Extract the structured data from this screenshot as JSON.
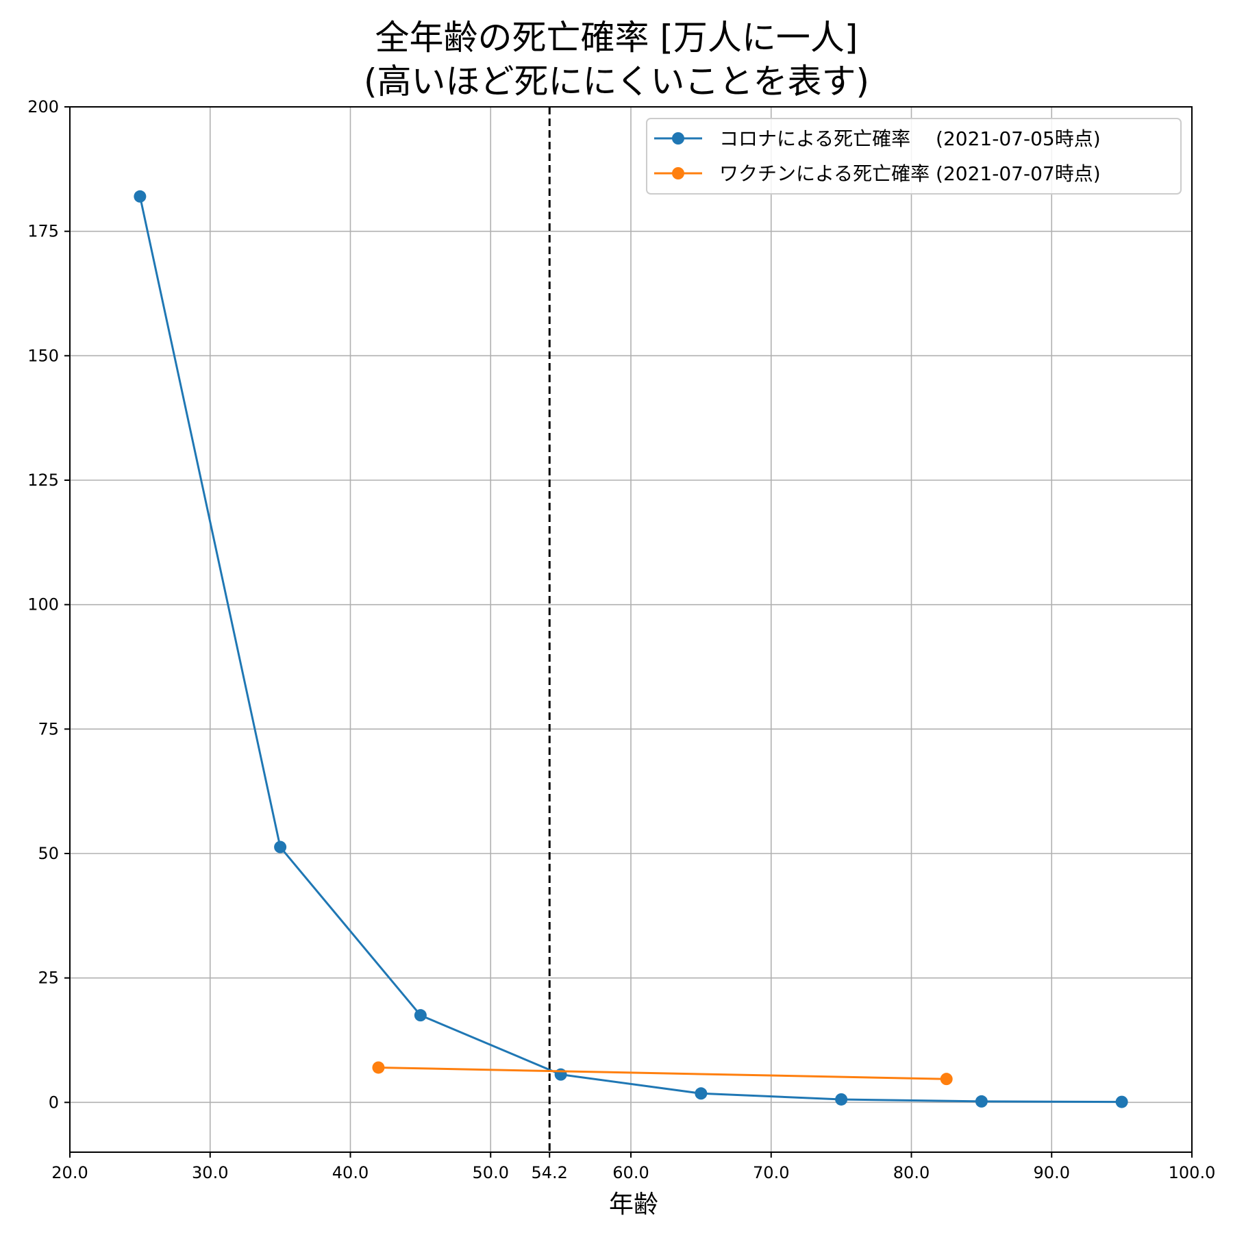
{
  "chart_data": {
    "type": "line",
    "title": "全年齢の死亡確率 [万人に一人]",
    "subtitle": "(高いほど死ににくいことを表す)",
    "xlabel": "年齢",
    "ylabel": "",
    "xlim": [
      20,
      100
    ],
    "ylim": [
      -10,
      200
    ],
    "xticks": [
      20,
      30,
      40,
      50,
      54.2,
      60,
      70,
      80,
      90,
      100
    ],
    "xtick_labels": [
      "20.0",
      "30.0",
      "40.0",
      "50.0",
      "54.2",
      "60.0",
      "70.0",
      "80.0",
      "90.0",
      "100.0"
    ],
    "yticks": [
      0,
      25,
      50,
      75,
      100,
      125,
      150,
      175,
      200
    ],
    "ytick_labels": [
      "0",
      "25",
      "50",
      "75",
      "100",
      "125",
      "150",
      "175",
      "200"
    ],
    "grid": true,
    "legend_position": "top-right",
    "vline": {
      "x": 54.2,
      "style": "dashed",
      "color": "#000000"
    },
    "series": [
      {
        "name": "コロナによる死亡確率　 (2021-07-05時点)",
        "color": "#1f77b4",
        "x": [
          25,
          35,
          45,
          55,
          65,
          75,
          85,
          95
        ],
        "y": [
          182,
          51.3,
          17.5,
          5.6,
          1.8,
          0.6,
          0.2,
          0.1
        ]
      },
      {
        "name": "ワクチンによる死亡確率 (2021-07-07時点)",
        "color": "#ff7f0e",
        "x": [
          42,
          82.5
        ],
        "y": [
          7.0,
          4.7
        ]
      }
    ]
  }
}
